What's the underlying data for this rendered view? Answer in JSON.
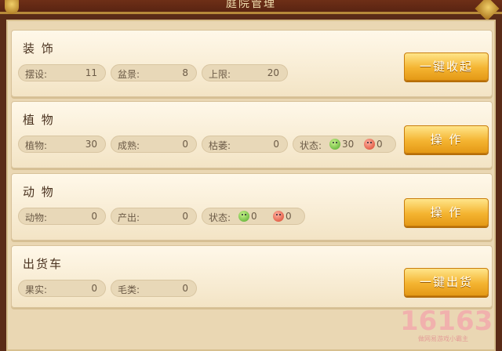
{
  "header": {
    "title": "庭院管理"
  },
  "sections": [
    {
      "title": "装 饰",
      "button": "一键收起",
      "stats": [
        {
          "label": "摆设:",
          "value": "11"
        },
        {
          "label": "盆景:",
          "value": "8"
        },
        {
          "label": "上限:",
          "value": "20"
        }
      ]
    },
    {
      "title": "植 物",
      "button": "操 作",
      "stats": [
        {
          "label": "植物:",
          "value": "30"
        },
        {
          "label": "成熟:",
          "value": "0"
        },
        {
          "label": "枯萎:",
          "value": "0"
        }
      ],
      "status": {
        "label": "状态:",
        "good": "30",
        "bad": "0"
      }
    },
    {
      "title": "动 物",
      "button": "操 作",
      "stats": [
        {
          "label": "动物:",
          "value": "0"
        },
        {
          "label": "产出:",
          "value": "0"
        }
      ],
      "status": {
        "label": "状态:",
        "good": "0",
        "bad": "0"
      }
    },
    {
      "title": "出货车",
      "button": "一键出货",
      "stats": [
        {
          "label": "果实:",
          "value": "0"
        },
        {
          "label": "毛类:",
          "value": "0"
        }
      ]
    }
  ],
  "watermark": {
    "main": "16163",
    "sub": "做网易游戏小霸主"
  },
  "icons": {
    "good_status": "green-smiley-icon",
    "bad_status": "red-angry-icon"
  },
  "colors": {
    "button_gold": "#f4b431",
    "card_bg": "#fff8e9",
    "frame_brown": "#5a2b17"
  }
}
